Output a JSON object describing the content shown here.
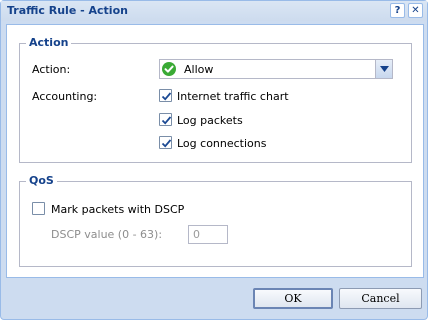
{
  "window": {
    "title": "Traffic Rule - Action",
    "help_icon": "?",
    "close_icon": "✕"
  },
  "action_section": {
    "legend": "Action",
    "action_label": "Action:",
    "action_value": "Allow",
    "action_icon": "check-circle-icon",
    "accounting_label": "Accounting:",
    "options": [
      {
        "label": "Internet traffic chart",
        "checked": true
      },
      {
        "label": "Log packets",
        "checked": true
      },
      {
        "label": "Log connections",
        "checked": true
      }
    ]
  },
  "qos_section": {
    "legend": "QoS",
    "mark_label": "Mark packets with DSCP",
    "mark_checked": false,
    "dscp_label": "DSCP value (0 - 63):",
    "dscp_value": "0"
  },
  "buttons": {
    "ok": "OK",
    "cancel": "Cancel"
  },
  "colors": {
    "accent": "#15428b",
    "allow_green": "#3aaa35"
  }
}
